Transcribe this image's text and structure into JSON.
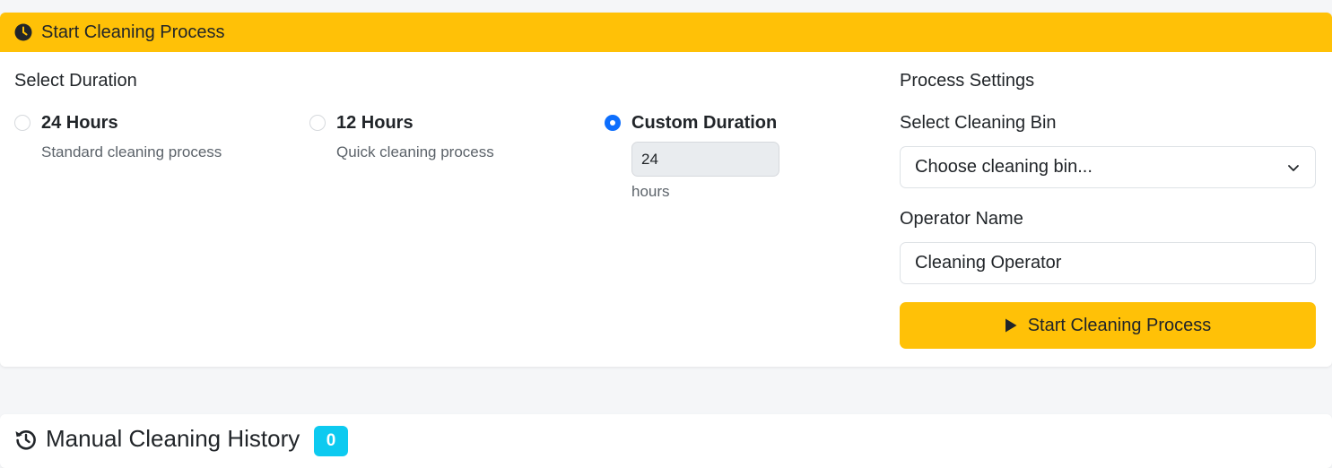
{
  "header": {
    "title": "Start Cleaning Process",
    "icon": "clock-icon",
    "color": "#ffc107"
  },
  "duration": {
    "section_title": "Select Duration",
    "options": [
      {
        "label": "24 Hours",
        "description": "Standard cleaning process",
        "checked": false
      },
      {
        "label": "12 Hours",
        "description": "Quick cleaning process",
        "checked": false
      },
      {
        "label": "Custom Duration",
        "checked": true,
        "input_value": "24",
        "unit": "hours"
      }
    ]
  },
  "settings": {
    "section_title": "Process Settings",
    "bin_label": "Select Cleaning Bin",
    "bin_select_value": "Choose cleaning bin...",
    "operator_label": "Operator Name",
    "operator_value": "Cleaning Operator",
    "start_button_label": "Start Cleaning Process",
    "start_button_icon": "play-icon"
  },
  "history": {
    "title": "Manual Cleaning History",
    "icon": "history-icon",
    "count": "0",
    "badge_color": "#0dcaf0"
  }
}
